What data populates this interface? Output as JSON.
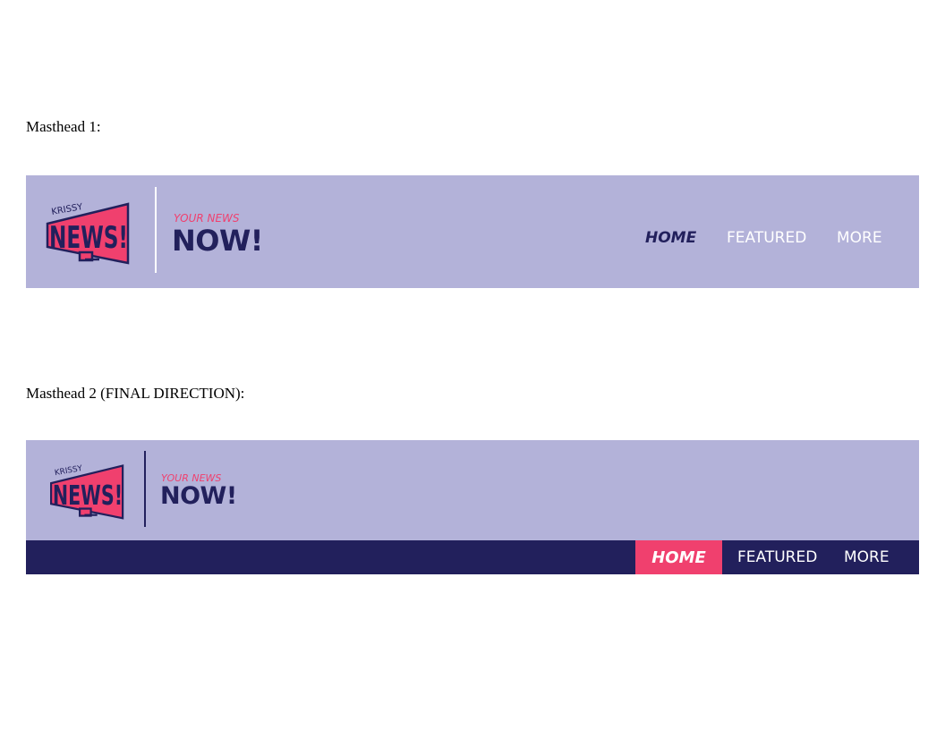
{
  "labels": {
    "masthead1": "Masthead 1:",
    "masthead2": "Masthead 2 (FINAL DIRECTION):"
  },
  "logo": {
    "top_text": "KRISSY",
    "main_text": "NEWS!",
    "icon": "megaphone-logo"
  },
  "brand": {
    "tagline": "YOUR NEWS",
    "headline": "NOW!"
  },
  "nav": {
    "home": "HOME",
    "featured": "FEATURED",
    "more": "MORE"
  },
  "colors": {
    "lavender": "#b3b2d9",
    "navy": "#22205c",
    "pink": "#f0406e",
    "white": "#ffffff"
  }
}
